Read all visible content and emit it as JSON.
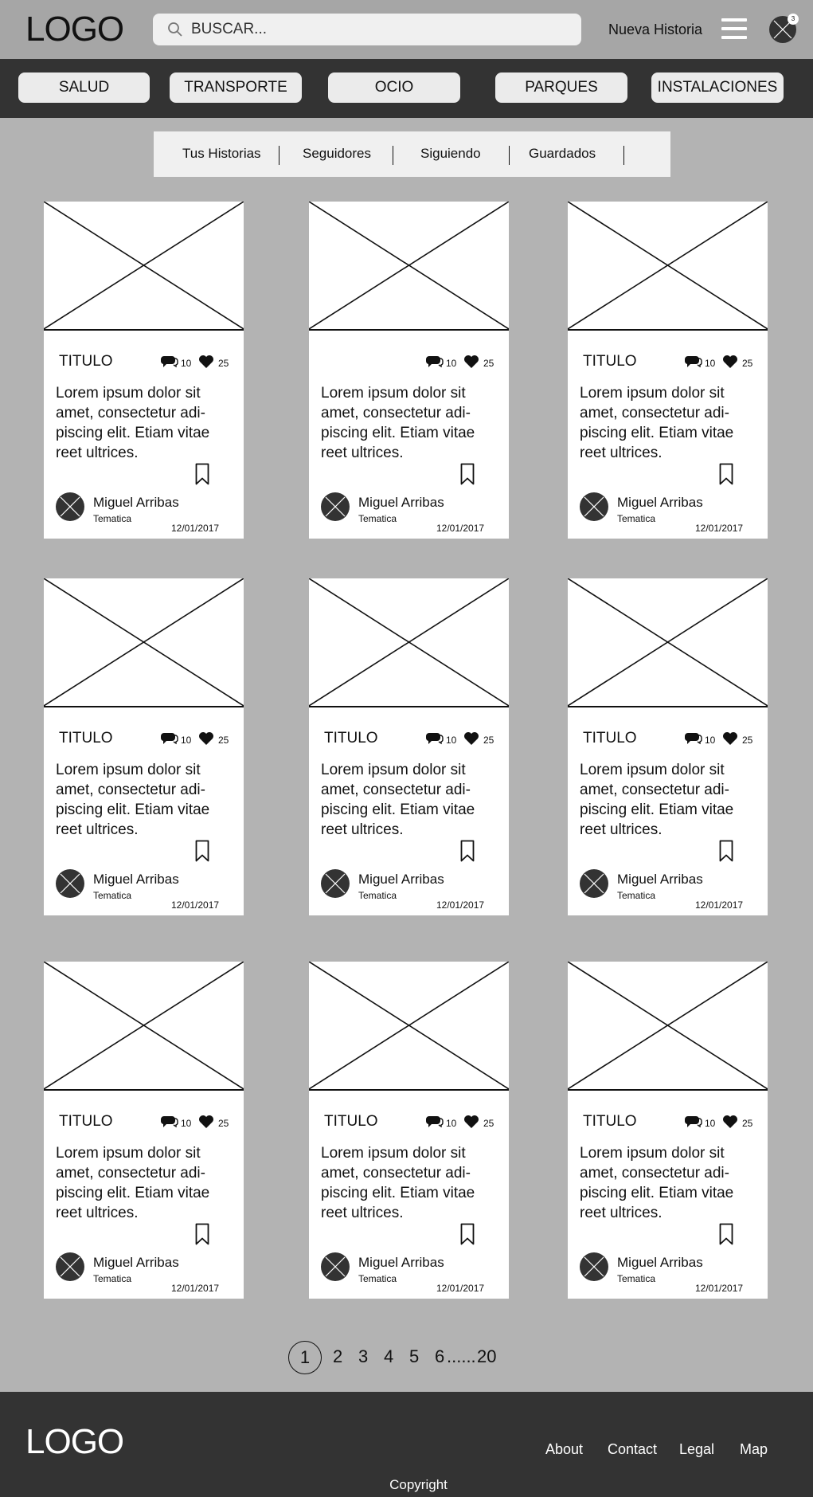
{
  "header": {
    "logo": "LOGO",
    "search_placeholder": "BUSCAR...",
    "new_story": "Nueva Historia",
    "notification_count": "3"
  },
  "categories": [
    "SALUD",
    "TRANSPORTE",
    "OCIO",
    "PARQUES",
    "INSTALACIONES"
  ],
  "tabs": [
    "Tus Historias",
    "Seguidores",
    "Siguiendo",
    "Guardados"
  ],
  "cards": [
    {
      "title": "TITULO",
      "comments": "10",
      "likes": "25",
      "body": "Lorem ipsum dolor sit amet, consectetur adi-piscing elit. Etiam vitae reet ultrices.",
      "author": "Miguel Arribas",
      "theme": "Tematica",
      "date": "12/01/2017"
    },
    {
      "title": "",
      "comments": "10",
      "likes": "25",
      "body": "Lorem ipsum dolor sit amet, consectetur adi-piscing elit. Etiam vitae reet ultrices.",
      "author": "Miguel Arribas",
      "theme": "Tematica",
      "date": "12/01/2017"
    },
    {
      "title": "TITULO",
      "comments": "10",
      "likes": "25",
      "body": "Lorem ipsum dolor sit amet, consectetur adi-piscing elit. Etiam vitae reet ultrices.",
      "author": "Miguel Arribas",
      "theme": "Tematica",
      "date": "12/01/2017"
    },
    {
      "title": "TITULO",
      "comments": "10",
      "likes": "25",
      "body": "Lorem ipsum dolor sit amet, consectetur adi-piscing elit. Etiam vitae reet ultrices.",
      "author": "Miguel Arribas",
      "theme": "Tematica",
      "date": "12/01/2017"
    },
    {
      "title": "TITULO",
      "comments": "10",
      "likes": "25",
      "body": "Lorem ipsum dolor sit amet, consectetur adi-piscing elit. Etiam vitae reet ultrices.",
      "author": "Miguel Arribas",
      "theme": "Tematica",
      "date": "12/01/2017"
    },
    {
      "title": "TITULO",
      "comments": "10",
      "likes": "25",
      "body": "Lorem ipsum dolor sit amet, consectetur adi-piscing elit. Etiam vitae reet ultrices.",
      "author": "Miguel Arribas",
      "theme": "Tematica",
      "date": "12/01/2017"
    },
    {
      "title": "TITULO",
      "comments": "10",
      "likes": "25",
      "body": "Lorem ipsum dolor sit amet, consectetur adi-piscing elit. Etiam vitae reet ultrices.",
      "author": "Miguel Arribas",
      "theme": "Tematica",
      "date": "12/01/2017"
    },
    {
      "title": "TITULO",
      "comments": "10",
      "likes": "25",
      "body": "Lorem ipsum dolor sit amet, consectetur adi-piscing elit. Etiam vitae reet ultrices.",
      "author": "Miguel Arribas",
      "theme": "Tematica",
      "date": "12/01/2017"
    },
    {
      "title": "TITULO",
      "comments": "10",
      "likes": "25",
      "body": "Lorem ipsum dolor sit amet, consectetur adi-piscing elit. Etiam vitae reet ultrices.",
      "author": "Miguel Arribas",
      "theme": "Tematica",
      "date": "12/01/2017"
    }
  ],
  "pagination": {
    "current": "1",
    "pages": [
      "2",
      "3",
      "4",
      "5",
      "6"
    ],
    "ellipsis": "......",
    "last": "20"
  },
  "footer": {
    "logo": "LOGO",
    "links": [
      "About",
      "Contact",
      "Legal",
      "Map"
    ],
    "copyright": "Copyright"
  },
  "colors": {
    "page_bg": "#b3b3b3",
    "header_bg": "#a6a6a6",
    "dark_bar": "#333333",
    "card_bg": "#ffffff"
  },
  "icons": [
    "search-icon",
    "hamburger-menu-icon",
    "comment-icon",
    "heart-icon",
    "bookmark-icon",
    "avatar-placeholder-icon",
    "image-placeholder-icon"
  ]
}
